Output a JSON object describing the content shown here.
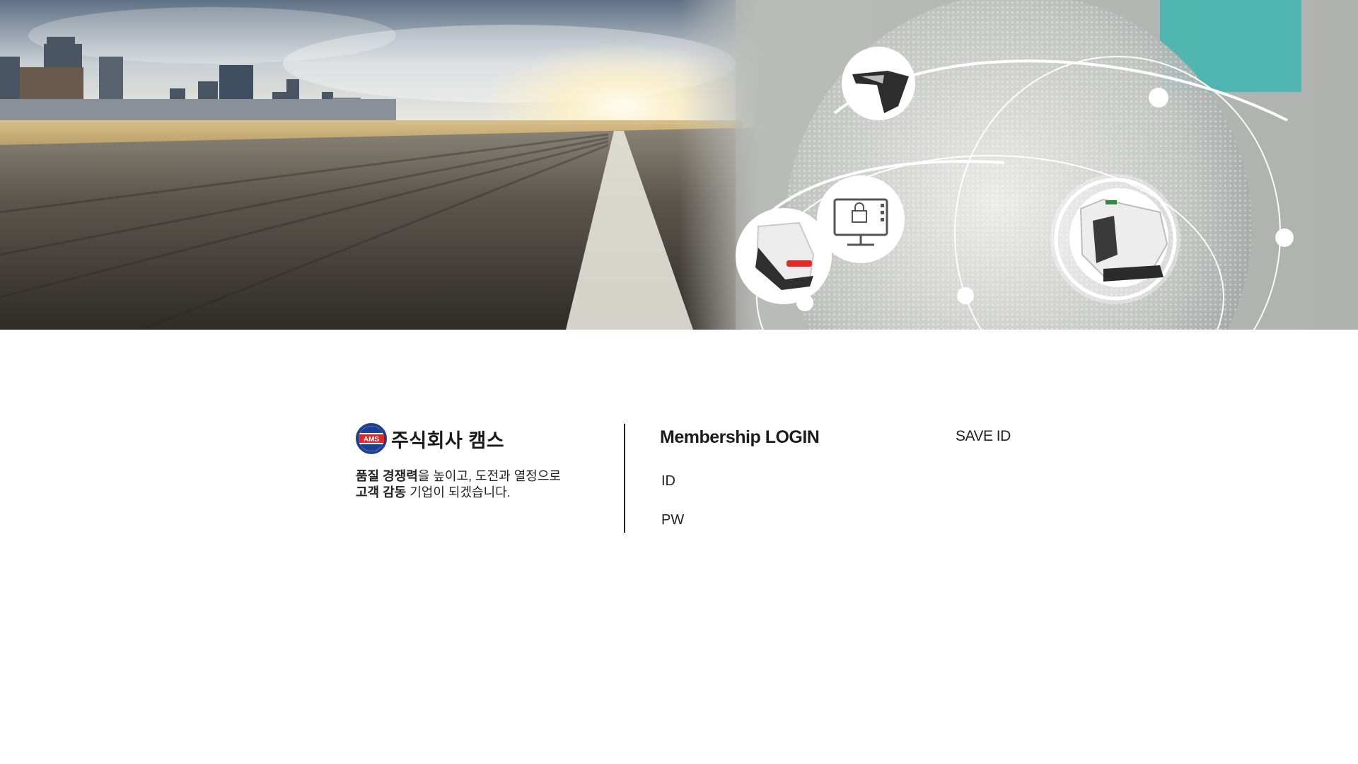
{
  "company": {
    "name": "주식회사 캠스",
    "logo_text": "AMS"
  },
  "slogan": {
    "line1_bold": "품질 경쟁력",
    "line1_rest": "을 높이고, 도전과 열정으로",
    "line2_bold": "고객 감동",
    "line2_rest": " 기업이 되겠습니다."
  },
  "login": {
    "title": "Membership LOGIN",
    "id_label": "ID",
    "pw_label": "PW",
    "save_id_label": "SAVE ID"
  },
  "hero": {
    "icons": [
      "car-part-icon",
      "monitor-lock-icon",
      "car-bumper-icon",
      "car-seat-part-icon"
    ]
  },
  "colors": {
    "logo_red": "#e02a2a",
    "logo_blue": "#1d3f8f",
    "divider": "#222222"
  }
}
